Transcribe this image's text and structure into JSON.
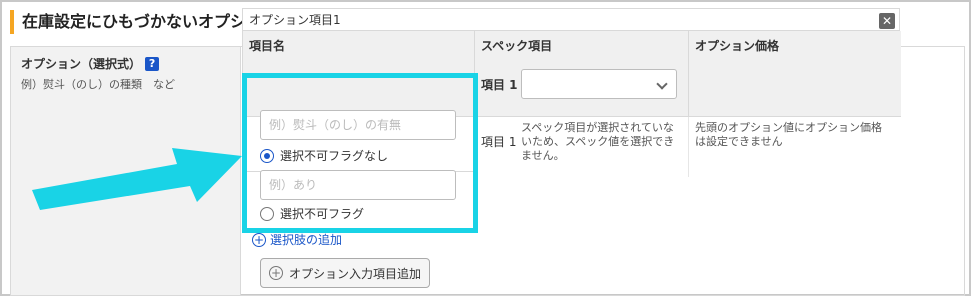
{
  "header": {
    "title": "在庫設定にひもづかないオプション・スペック設定"
  },
  "label_col": {
    "title": "オプション（選択式）",
    "help": "?",
    "example": "例）熨斗（のし）の種類　など"
  },
  "option": {
    "name": "オプション項目1",
    "close": "✕",
    "columns": [
      "項目名",
      "スペック項目",
      "オプション価格"
    ],
    "spec_item_label": "項目 1",
    "rows": [
      {
        "name_placeholder": "例）熨斗（のし）の有無",
        "radio_label": "選択不可フラグなし",
        "radio_selected": true
      },
      {
        "name_placeholder": "例）あり",
        "radio_label": "選択不可フラグ",
        "radio_selected": false,
        "spec_item_label": "項目 1",
        "spec_note": "スペック項目が選択されていないため、スペック値を選択できません。",
        "price_note": "先頭のオプション値にオプション価格は設定できません"
      }
    ]
  },
  "actions": {
    "add_choice": "選択肢の追加",
    "add_option_item": "オプション入力項目追加"
  },
  "icons": {
    "help": "help-icon",
    "close": "close-icon",
    "add": "plus-circle-icon",
    "chevron": "chevron-down-icon",
    "arrow": "pointer-arrow-icon"
  },
  "colors": {
    "accent": "#1a56c8",
    "header_bar": "#f5a623",
    "highlight": "#19d3e6"
  }
}
